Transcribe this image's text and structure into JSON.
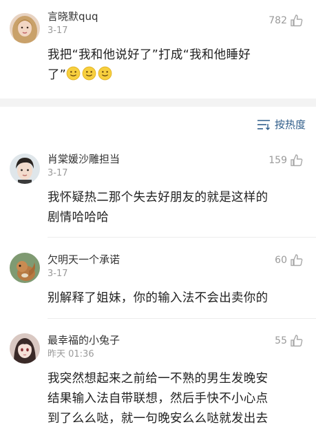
{
  "comments": [
    {
      "username": "言晓默quq",
      "date": "3-17",
      "likes": "782",
      "text_lines": [
        "我把“我和他说好了”打成“我和他睡好",
        "了”"
      ],
      "emoji_count": 3,
      "avatar": "avatar-blonde-girl"
    },
    {
      "username": "肖棠媛沙雕担当",
      "date": "3-17",
      "likes": "159",
      "text_lines": [
        "我怀疑热二那个失去好朋友的就是这样的",
        "剧情哈哈哈"
      ],
      "avatar": "avatar-boy-portrait"
    },
    {
      "username": "欠明天一个承诺",
      "date": "3-17",
      "likes": "60",
      "text_lines": [
        "别解释了姐妹，你的输入法不会出卖你的"
      ],
      "avatar": "avatar-squirrel"
    },
    {
      "username": "最幸福的小兔子",
      "date": "昨天 01:36",
      "likes": "55",
      "text_lines": [
        "我突然想起来之前给一不熟的男生发晚安",
        "结果输入法自带联想，然后手快不小心点",
        "到了么么哒，就一句晚安么么哒就发出去"
      ],
      "avatar": "avatar-anime-girl"
    }
  ],
  "sort": {
    "label": "按热度",
    "icon": "sort-lines-icon"
  },
  "colors": {
    "sort_accent": "#2f5d8a",
    "meta_gray": "#9a9a9a",
    "section_gap": "#f3f3f3"
  }
}
